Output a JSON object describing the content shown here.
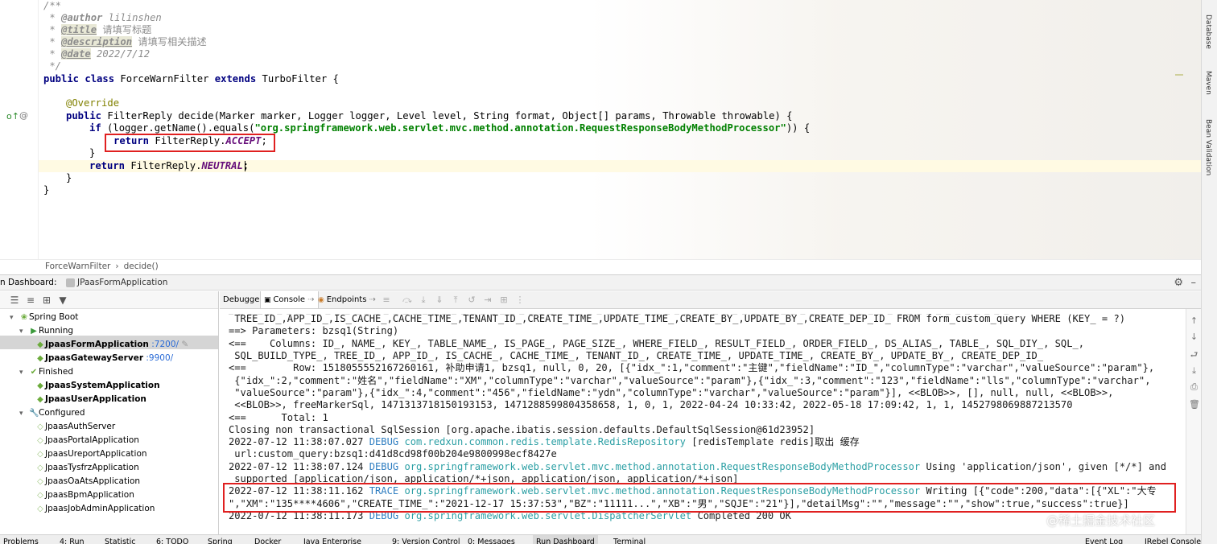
{
  "editor": {
    "comment_open": "/**",
    "author_tag": "@author",
    "author_value": " lilinshen",
    "title_tag": "@title",
    "title_value": " 请填写标题",
    "desc_tag": "@description",
    "desc_value": " 请填写相关描述",
    "date_tag": "@date",
    "date_value": " 2022/7/12",
    "comment_close": " */",
    "class_kw": "public class ",
    "class_name": "ForceWarnFilter ",
    "extends_kw": "extends ",
    "class_rest": "TurboFilter {",
    "override": "@Override",
    "method_kw": "public ",
    "method_sig": "FilterReply decide(Marker marker, Logger logger, Level level, String format, Object[] params, Throwable throwable) {",
    "if_kw": "if ",
    "if_pre": "(logger.getName().equals(",
    "if_str": "\"org.springframework.web.servlet.mvc.method.annotation.RequestResponseBodyMethodProcessor\"",
    "if_post": ")) {",
    "return_kw": "return ",
    "return1_pre": "FilterReply.",
    "return1_const": "ACCEPT",
    "return1_post": ";",
    "close_brace_if": "}",
    "return2_pre": "FilterReply.",
    "return2_const": "NEUTRAL",
    "return2_post": ";",
    "close_brace_method": "}",
    "close_brace_class": "}"
  },
  "right_strip": [
    "Database",
    "Maven",
    "Bean Validation"
  ],
  "breadcrumb": [
    "ForceWarnFilter",
    "›",
    "decide()"
  ],
  "dashboard": {
    "label": "n Dashboard:",
    "tab": "JPaasFormApplication"
  },
  "tree": {
    "spring_boot": "Spring Boot",
    "running": "Running",
    "finished": "Finished",
    "configured": "Configured",
    "running_apps": [
      {
        "name": "JpaasFormApplication",
        "port": ":7200/"
      },
      {
        "name": "JpaasGatewayServer",
        "port": ":9900/"
      }
    ],
    "finished_apps": [
      "JpaasSystemApplication",
      "JpaasUserApplication"
    ],
    "configured_apps": [
      "JpaasAuthServer",
      "JpaasPortalApplication",
      "JpaasUreportApplication",
      "JpaasTysfrzApplication",
      "JpaasOaAtsApplication",
      "JpaasBpmApplication",
      "JpaasJobAdminApplication"
    ]
  },
  "console_tabs": {
    "debugger": "Debugger",
    "console": "Console",
    "endpoints": "Endpoints"
  },
  "console": {
    "l0": " TREE_ID_,APP_ID_,IS_CACHE_,CACHE_TIME_,TENANT_ID_,CREATE_TIME_,UPDATE_TIME_,CREATE_BY_,UPDATE_BY_,CREATE_DEP_ID_ FROM form_custom_query WHERE (KEY_ = ?)",
    "l1": "==> Parameters: bzsq1(String)",
    "l2": "<==    Columns: ID_, NAME_, KEY_, TABLE_NAME_, IS_PAGE_, PAGE_SIZE_, WHERE_FIELD_, RESULT_FIELD_, ORDER_FIELD_, DS_ALIAS_, TABLE_, SQL_DIY_, SQL_,",
    "l3": " SQL_BUILD_TYPE_, TREE_ID_, APP_ID_, IS_CACHE_, CACHE_TIME_, TENANT_ID_, CREATE_TIME_, UPDATE_TIME_, CREATE_BY_, UPDATE_BY_, CREATE_DEP_ID_",
    "l4": "<==        Row: 1518055552167260161, 补助申请1, bzsq1, null, 0, 20, [{\"idx_\":1,\"comment\":\"主键\",\"fieldName\":\"ID_\",\"columnType\":\"varchar\",\"valueSource\":\"param\"},",
    "l5": " {\"idx_\":2,\"comment\":\"姓名\",\"fieldName\":\"XM\",\"columnType\":\"varchar\",\"valueSource\":\"param\"},{\"idx_\":3,\"comment\":\"123\",\"fieldName\":\"lls\",\"columnType\":\"varchar\",",
    "l6": " \"valueSource\":\"param\"},{\"idx_\":4,\"comment\":\"456\",\"fieldName\":\"ydn\",\"columnType\":\"varchar\",\"valueSource\":\"param\"}], <<BLOB>>, [], null, null, <<BLOB>>,",
    "l7": " <<BLOB>>, freeMarkerSql, 1471313718150193153, 1471288599804358658, 1, 0, 1, 2022-04-24 10:33:42, 2022-05-18 17:09:42, 1, 1, 1452798069887213570",
    "l8": "<==      Total: 1",
    "l9": "Closing non transactional SqlSession [org.apache.ibatis.session.defaults.DefaultSqlSession@61d23952]",
    "l10_time": "2022-07-12 11:38:07.027 ",
    "l10_level": "DEBUG ",
    "l10_class": "com.redxun.common.redis.template.RedisRepository",
    "l10_msg": " [redisTemplate redis]取出 缓存",
    "l11": " url:custom_query:bzsq1:d41d8cd98f00b204e9800998ecf8427e",
    "l12_time": "2022-07-12 11:38:07.124 ",
    "l12_level": "DEBUG ",
    "l12_class": "org.springframework.web.servlet.mvc.method.annotation.RequestResponseBodyMethodProcessor",
    "l12_msg": " Using 'application/json', given [*/*] and",
    "l13": " supported [application/json, application/*+json, application/json, application/*+json]",
    "l14_time": "2022-07-12 11:38:11.162 ",
    "l14_level": "TRACE ",
    "l14_class": "org.springframework.web.servlet.mvc.method.annotation.RequestResponseBodyMethodProcessor",
    "l14_msg": " Writing [{\"code\":200,\"data\":[{\"XL\":\"大专",
    "l15": "\",\"XM\":\"135****4606\",\"CREATE_TIME_\":\"2021-12-17 15:37:53\",\"BZ\":\"11111...\",\"XB\":\"男\",\"SQJE\":\"21\"}],\"detailMsg\":\"\",\"message\":\"\",\"show\":true,\"success\":true}]",
    "l16_time": "2022-07-12 11:38:11.173 ",
    "l16_level": "DEBUG ",
    "l16_class": "org.springframework.web.servlet.DispatcherServlet",
    "l16_msg": " Completed 200 OK"
  },
  "watermark": "@稀土掘金技术社区",
  "bottom_bar": [
    "Problems",
    "4: Run",
    "Statistic",
    "6: TODO",
    "Spring",
    "Docker",
    "Java Enterprise",
    "9: Version Control",
    "0: Messages",
    "Run Dashboard",
    "Terminal",
    "Event Log",
    "JRebel Console"
  ],
  "colors": {
    "highlight_box": "#e02020",
    "keyword": "#000080",
    "string": "#008000",
    "constant": "#660e7a",
    "debug_level": "#2f7ec1",
    "logger_class": "#2b9fa4"
  }
}
